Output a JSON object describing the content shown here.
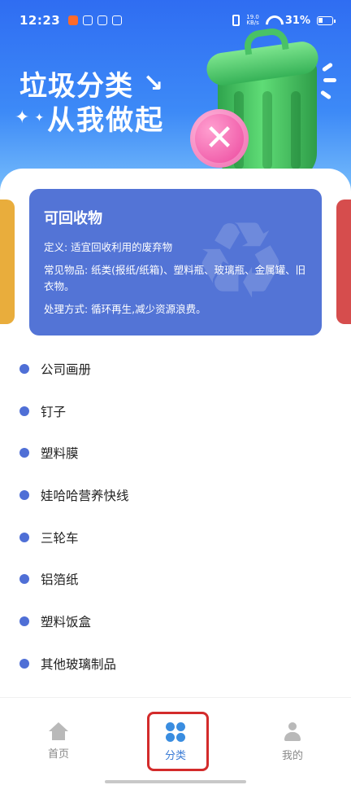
{
  "status_bar": {
    "time": "12:23",
    "net_speed_value": "19.0",
    "net_speed_unit": "KB/s",
    "battery": "31%"
  },
  "hero": {
    "title_line1": "垃圾分类",
    "title_line2": "从我做起"
  },
  "card": {
    "title": "可回收物",
    "definition": "定义: 适宜回收利用的废弃物",
    "common_items": "常见物品: 纸类(报纸/纸箱)、塑料瓶、玻璃瓶、金属罐、旧衣物。",
    "treatment": "处理方式: 循环再生,减少资源浪费。"
  },
  "items": [
    "公司画册",
    "钉子",
    "塑料膜",
    "娃哈哈营养快线",
    "三轮车",
    "铝箔纸",
    "塑料饭盒",
    "其他玻璃制品"
  ],
  "nav": {
    "home": "首页",
    "category": "分类",
    "mine": "我的",
    "active": "category"
  },
  "colors": {
    "card_recyclable": "#5374d6",
    "card_peek_left": "#e9ad3c",
    "card_peek_right": "#d64d4d",
    "accent": "#3a7bd5",
    "highlight": "#d32b2b"
  },
  "icons": {
    "card_watermark": "recycle-icon",
    "hero_arrow": "arrow-down-right-icon",
    "home": "home-icon",
    "category": "grid-icon",
    "mine": "user-icon"
  }
}
